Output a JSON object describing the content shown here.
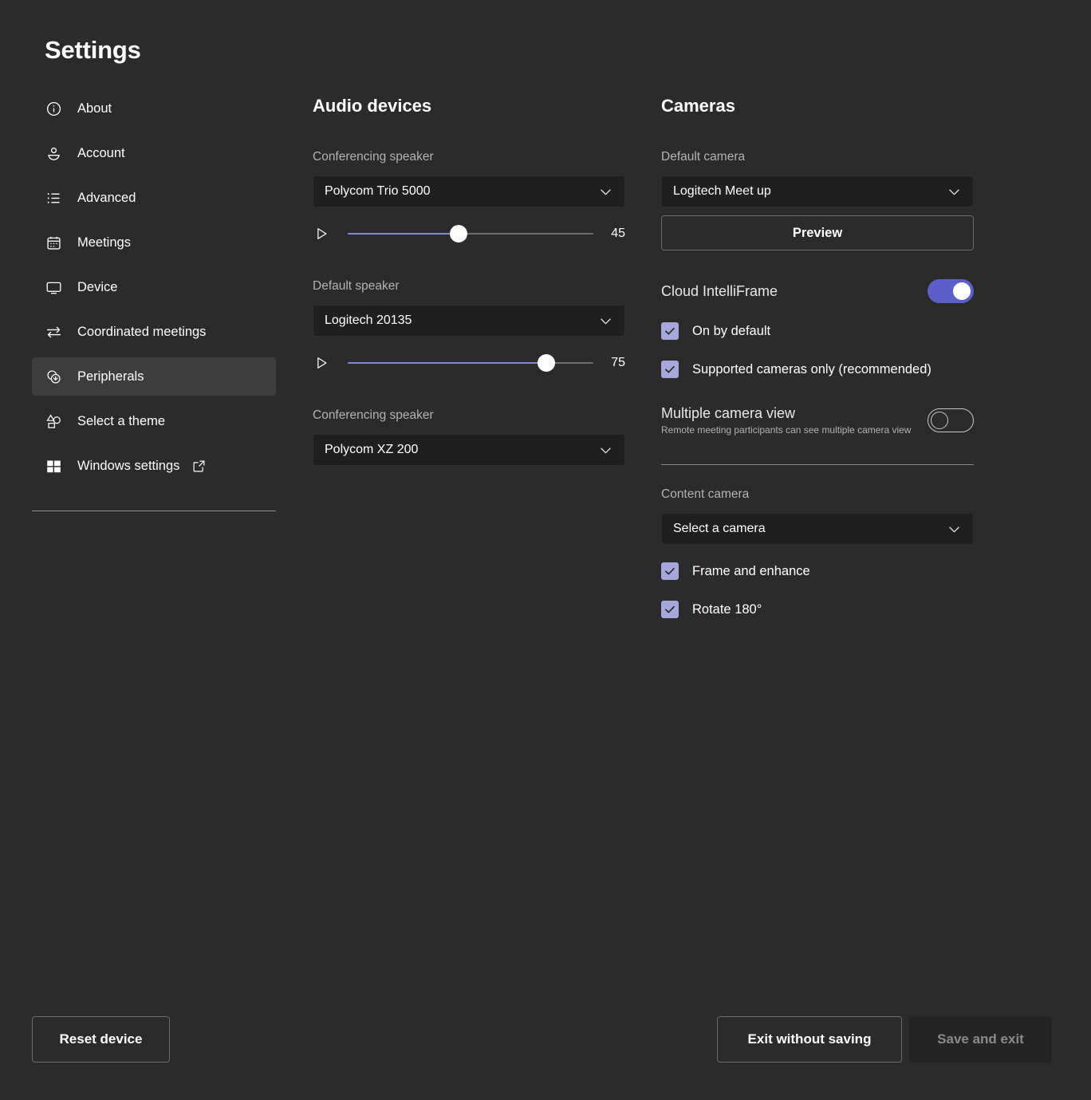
{
  "app": {
    "title": "Settings"
  },
  "sidebar": {
    "items": [
      {
        "label": "About",
        "icon": "info-circle-icon",
        "active": false
      },
      {
        "label": "Account",
        "icon": "person-icon",
        "active": false
      },
      {
        "label": "Advanced",
        "icon": "list-icon",
        "active": false
      },
      {
        "label": "Meetings",
        "icon": "calendar-icon",
        "active": false
      },
      {
        "label": "Device",
        "icon": "monitor-icon",
        "active": false
      },
      {
        "label": "Coordinated meetings",
        "icon": "arrows-swap-icon",
        "active": false
      },
      {
        "label": "Peripherals",
        "icon": "peripherals-icon",
        "active": true
      },
      {
        "label": "Select a theme",
        "icon": "shapes-icon",
        "active": false
      },
      {
        "label": "Windows settings",
        "icon": "windows-logo-icon",
        "active": false,
        "external": true,
        "external_icon": "external-link-icon"
      }
    ]
  },
  "audio": {
    "heading": "Audio devices",
    "conferencing_speaker_label": "Conferencing speaker",
    "conferencing_speaker_value": "Polycom Trio 5000",
    "conferencing_speaker_volume": 45,
    "default_speaker_label": "Default speaker",
    "default_speaker_value": "Logitech 20135",
    "default_speaker_volume": 75,
    "conferencing_mic_label": "Conferencing speaker",
    "conferencing_mic_value": "Polycom XZ 200",
    "play_icon": "play-icon",
    "chevron_icon": "chevron-down-icon"
  },
  "cameras": {
    "heading": "Cameras",
    "default_camera_label": "Default camera",
    "default_camera_value": "Logitech Meet up",
    "preview_label": "Preview",
    "cloud_intelliframe_label": "Cloud IntelliFrame",
    "cloud_intelliframe_on": true,
    "on_by_default_label": "On by default",
    "on_by_default_checked": true,
    "supported_cameras_label": "Supported cameras only (recommended)",
    "supported_cameras_checked": true,
    "multiple_camera_view_label": "Multiple camera view",
    "multiple_camera_view_desc": "Remote meeting participants can see multiple camera view",
    "multiple_camera_view_on": false,
    "content_camera_label": "Content camera",
    "content_camera_value": "Select a camera",
    "frame_enhance_label": "Frame and enhance",
    "frame_enhance_checked": true,
    "rotate_label": "Rotate 180°",
    "rotate_checked": true,
    "chevron_icon": "chevron-down-icon",
    "check_icon": "checkmark-icon"
  },
  "footer": {
    "reset_device_label": "Reset device",
    "exit_without_saving_label": "Exit without saving",
    "save_and_exit_label": "Save and exit",
    "save_and_exit_disabled": true
  },
  "colors": {
    "page_background": "#2b2b2b",
    "field_background": "#1f1f1f",
    "accent_toggle": "#5b5fc7",
    "accent_checkbox": "#a6a7dc",
    "slider_fill": "#7f85e0",
    "slider_track": "#6e6e6e",
    "active_nav_background": "#3d3d3d",
    "muted_text": "#b3b3b3",
    "disabled_text": "#8a8a8a"
  }
}
